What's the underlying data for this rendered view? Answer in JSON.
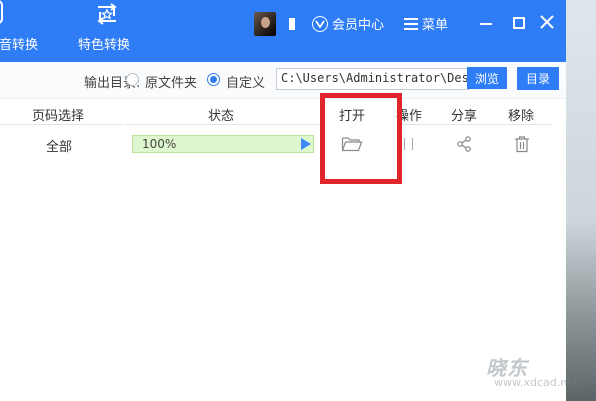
{
  "topbar": {
    "nav_voice_label": "语音转换",
    "nav_special_label": "特色转换",
    "vip_label": "会员中心",
    "menu_label": "菜单",
    "accent": "#2f7df6"
  },
  "toolbar": {
    "output_label": "输出目录:",
    "radio_original": "原文件夹",
    "radio_custom": "自定义",
    "selected": "自定义",
    "path_value": "C:\\Users\\Administrator\\Desktop",
    "browse_label": "浏览",
    "dir_label": "目录"
  },
  "table": {
    "headers": {
      "page": "页码选择",
      "status": "状态",
      "open": "打开",
      "action": "操作",
      "share": "分享",
      "remove": "移除"
    },
    "rows": [
      {
        "page": "全部",
        "progress_text": "100%",
        "progress": 1.0
      }
    ]
  },
  "watermark": {
    "main": "晓东",
    "sub": "www.xdcad.net"
  },
  "colors": {
    "highlight": "#e0262c",
    "progress_bg": "#dff7cf"
  }
}
